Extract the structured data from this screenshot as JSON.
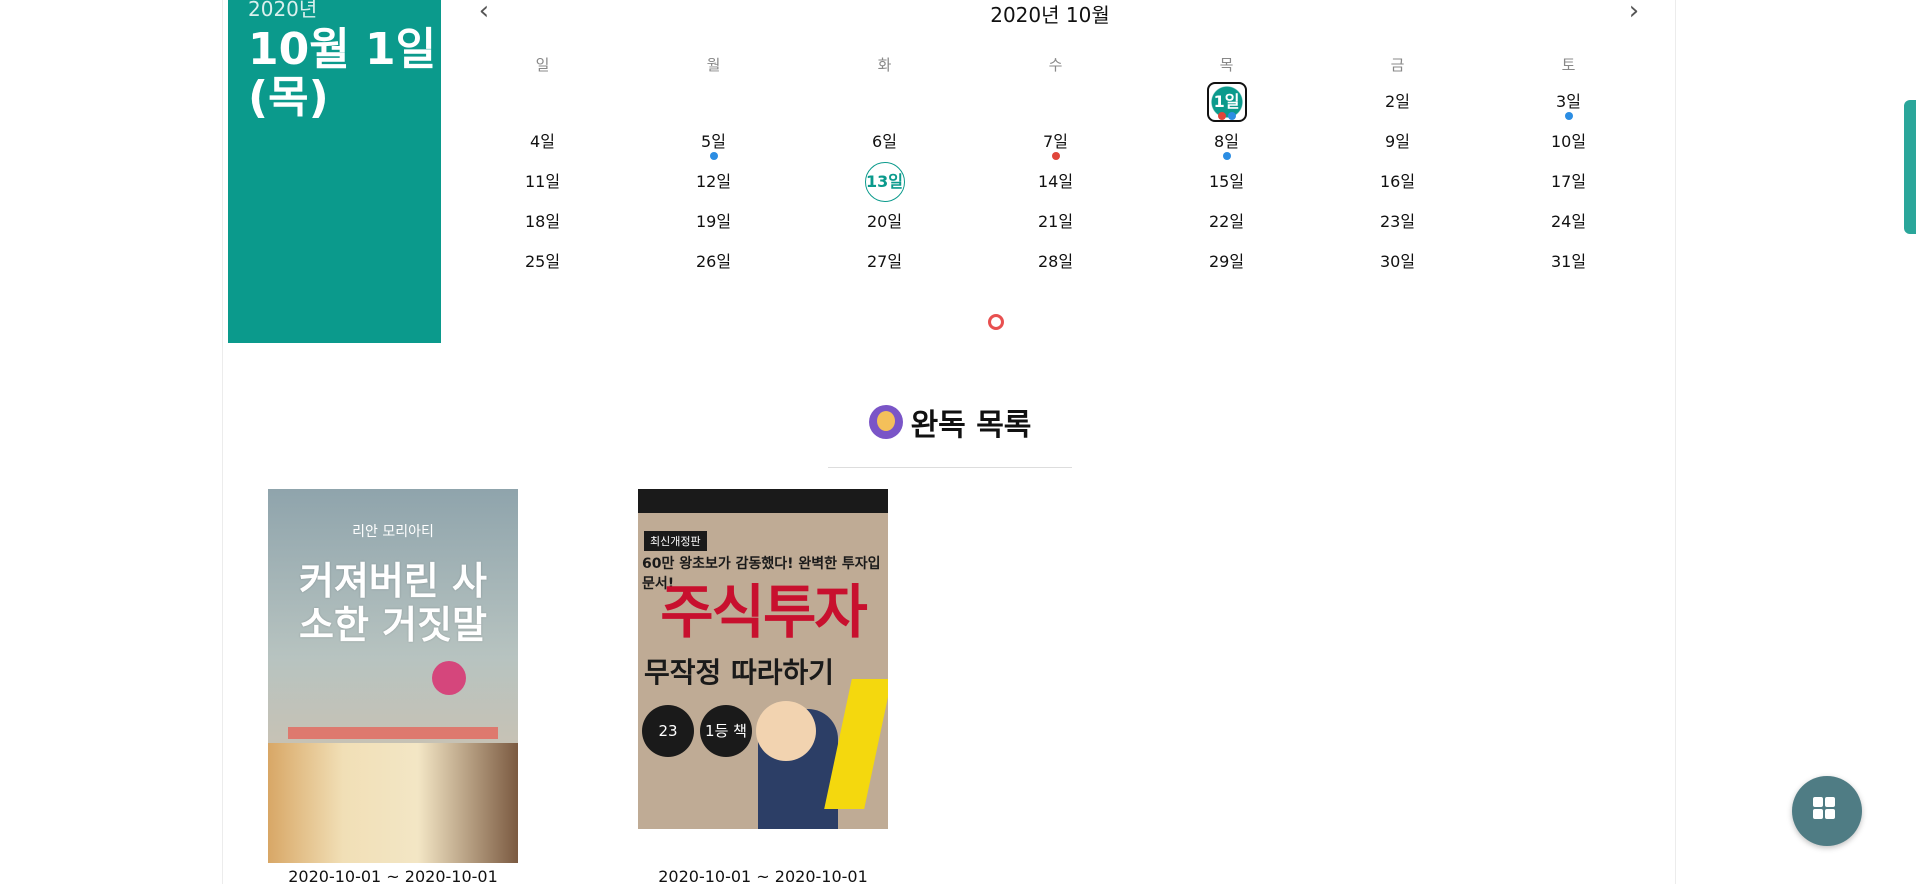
{
  "date_panel": {
    "year": "2020년",
    "day_line1": "10월 1일",
    "day_line2": "(목)"
  },
  "calendar": {
    "title": "2020년 10월",
    "prev_icon": "chevron-left-icon",
    "next_icon": "chevron-right-icon",
    "weekdays": [
      "일",
      "월",
      "화",
      "수",
      "목",
      "금",
      "토"
    ],
    "weeks": [
      [
        {
          "label": ""
        },
        {
          "label": ""
        },
        {
          "label": ""
        },
        {
          "label": ""
        },
        {
          "label": "1일",
          "state": "selected",
          "dots": [
            "red",
            "blue"
          ]
        },
        {
          "label": "2일"
        },
        {
          "label": "3일",
          "dots": [
            "blue"
          ]
        }
      ],
      [
        {
          "label": "4일"
        },
        {
          "label": "5일",
          "dots": [
            "blue"
          ]
        },
        {
          "label": "6일"
        },
        {
          "label": "7일",
          "dots": [
            "red"
          ]
        },
        {
          "label": "8일",
          "dots": [
            "blue"
          ]
        },
        {
          "label": "9일"
        },
        {
          "label": "10일"
        }
      ],
      [
        {
          "label": "11일"
        },
        {
          "label": "12일"
        },
        {
          "label": "13일",
          "state": "today"
        },
        {
          "label": "14일"
        },
        {
          "label": "15일"
        },
        {
          "label": "16일"
        },
        {
          "label": "17일"
        }
      ],
      [
        {
          "label": "18일"
        },
        {
          "label": "19일"
        },
        {
          "label": "20일"
        },
        {
          "label": "21일"
        },
        {
          "label": "22일"
        },
        {
          "label": "23일"
        },
        {
          "label": "24일"
        }
      ],
      [
        {
          "label": "25일"
        },
        {
          "label": "26일"
        },
        {
          "label": "27일"
        },
        {
          "label": "28일"
        },
        {
          "label": "29일"
        },
        {
          "label": "30일"
        },
        {
          "label": "31일"
        }
      ]
    ],
    "dot_colors": {
      "blue": "#2b8de3",
      "red": "#e0453a"
    }
  },
  "section": {
    "title": "완독 목록",
    "icon": "reader-emoji-icon"
  },
  "books": [
    {
      "range": "2020-10-01 ~ 2020-10-01",
      "cover_top": "리안 모리아티",
      "cover_title": "커져버린 사소한 거짓말"
    },
    {
      "range": "2020-10-01 ~ 2020-10-01",
      "cover_tag": "최신개정판",
      "cover_sub": "60만 왕초보가 감동했다! 완벽한 투자입문서!",
      "cover_title": "주식투자",
      "cover_sub2": "무작정 따라하기",
      "badge1": "23",
      "badge2": "1등 책"
    }
  ],
  "accent_color": "#0b9a8c",
  "fab_icon": "grid-icon"
}
